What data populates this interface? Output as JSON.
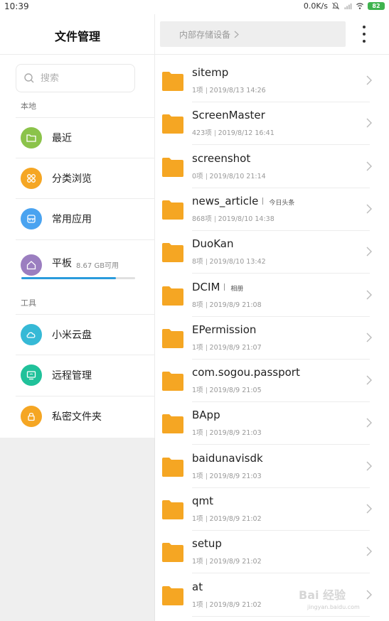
{
  "status_bar": {
    "time": "10:39",
    "network_speed": "0.0K/s",
    "battery": "82"
  },
  "sidebar": {
    "title": "文件管理",
    "search_placeholder": "搜索",
    "section_local": "本地",
    "section_tools": "工具",
    "local_items": [
      {
        "label": "最近",
        "icon": "folder-icon",
        "color": "#8bc34a"
      },
      {
        "label": "分类浏览",
        "icon": "category-icon",
        "color": "#f5a623"
      },
      {
        "label": "常用应用",
        "icon": "apps-icon",
        "color": "#4aa3f0"
      }
    ],
    "storage": {
      "label": "平板",
      "available": "8.67 GB可用",
      "icon": "home-icon",
      "color": "#9b7ec0",
      "used_fraction": 0.83
    },
    "tool_items": [
      {
        "label": "小米云盘",
        "icon": "cloud-icon",
        "color": "#36b9d6"
      },
      {
        "label": "远程管理",
        "icon": "remote-icon",
        "color": "#20c19a"
      },
      {
        "label": "私密文件夹",
        "icon": "lock-icon",
        "color": "#f5a623"
      }
    ]
  },
  "main": {
    "path_label": "内部存储设备",
    "folder_color": "#f5a623",
    "folders": [
      {
        "name": "sitemp",
        "count": "1项",
        "date": "2019/8/13 14:26",
        "tag": ""
      },
      {
        "name": "ScreenMaster",
        "count": "423项",
        "date": "2019/8/12 16:41",
        "tag": ""
      },
      {
        "name": "screenshot",
        "count": "0项",
        "date": "2019/8/10 21:14",
        "tag": ""
      },
      {
        "name": "news_article",
        "count": "868项",
        "date": "2019/8/10 14:38",
        "tag": "今日头条"
      },
      {
        "name": "DuoKan",
        "count": "8项",
        "date": "2019/8/10 13:42",
        "tag": ""
      },
      {
        "name": "DCIM",
        "count": "8项",
        "date": "2019/8/9 21:08",
        "tag": "相册"
      },
      {
        "name": "EPermission",
        "count": "1项",
        "date": "2019/8/9 21:07",
        "tag": ""
      },
      {
        "name": "com.sogou.passport",
        "count": "1项",
        "date": "2019/8/9 21:05",
        "tag": ""
      },
      {
        "name": "BApp",
        "count": "1项",
        "date": "2019/8/9 21:03",
        "tag": ""
      },
      {
        "name": "baidunavisdk",
        "count": "1项",
        "date": "2019/8/9 21:03",
        "tag": ""
      },
      {
        "name": "qmt",
        "count": "1项",
        "date": "2019/8/9 21:02",
        "tag": ""
      },
      {
        "name": "setup",
        "count": "1项",
        "date": "2019/8/9 21:02",
        "tag": ""
      },
      {
        "name": "at",
        "count": "1项",
        "date": "2019/8/9 21:02",
        "tag": ""
      }
    ]
  },
  "watermark": {
    "text": "Bai 经验",
    "url": "jingyan.baidu.com"
  }
}
